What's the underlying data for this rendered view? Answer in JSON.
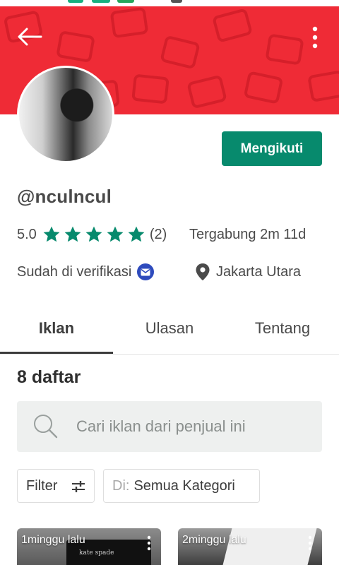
{
  "header": {
    "brand_color": "#ef2b36",
    "back_icon": "arrow-left-icon",
    "more_icon": "more-vertical-icon"
  },
  "profile": {
    "follow_label": "Mengikuti",
    "follow_color": "#078a6d",
    "username": "@nculncul",
    "rating_value": "5.0",
    "rating_stars": 5,
    "rating_count": "(2)",
    "joined": "Tergabung 2m 11d",
    "verified_label": "Sudah di verifikasi",
    "location": "Jakarta Utara"
  },
  "tabs": [
    {
      "label": "Iklan",
      "active": true
    },
    {
      "label": "Ulasan",
      "active": false
    },
    {
      "label": "Tentang",
      "active": false
    }
  ],
  "listings": {
    "count_label": "8 daftar",
    "search_placeholder": "Cari iklan dari penjual ini",
    "filter_label": "Filter",
    "category_prefix": "Di:",
    "category_value": "Semua Kategori",
    "cards": [
      {
        "time": "1minggu lalu",
        "brand_text": "kate spade"
      },
      {
        "time": "2minggu lalu"
      }
    ]
  }
}
